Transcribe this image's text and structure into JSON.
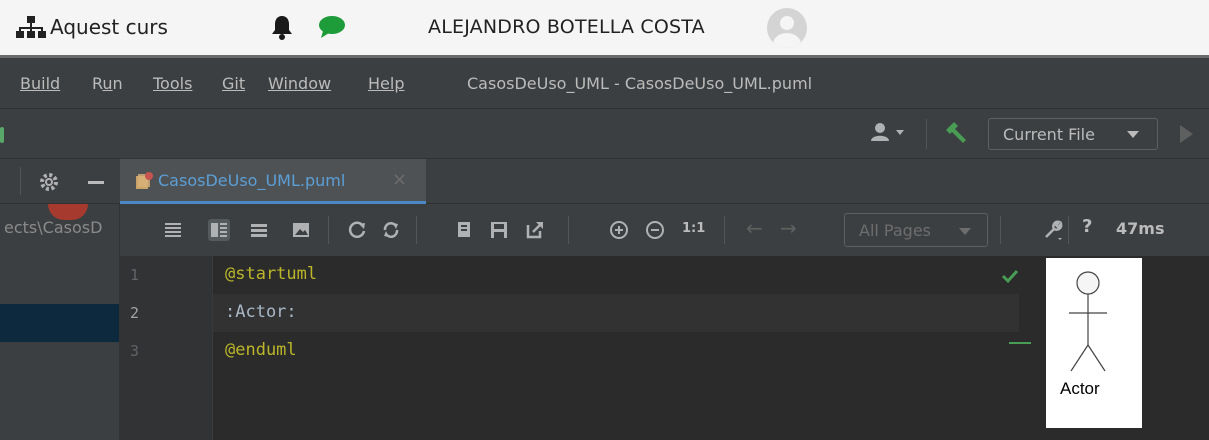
{
  "browser_bar": {
    "site_label": "Aquest curs",
    "user_name": "ALEJANDRO BOTELLA COSTA",
    "icons": [
      "sitemap-icon",
      "bell-icon",
      "chat-icon",
      "avatar-icon"
    ],
    "chat_color": "#1e9c3a"
  },
  "menu": {
    "items": [
      "Build",
      "Run",
      "Tools",
      "Git",
      "Window",
      "Help"
    ],
    "underline_index": [
      0,
      1,
      0,
      0,
      0,
      0
    ],
    "window_title": "CasosDeUso_UML - CasosDeUso_UML.puml"
  },
  "toolbar": {
    "run_config": "Current File"
  },
  "tabs": [
    {
      "label": "CasosDeUso_UML.puml",
      "active": true
    }
  ],
  "project_panel": {
    "path_fragment": "ects\\CasosD"
  },
  "plantuml_toolbar": {
    "zoom_reset": "1:1",
    "pages_select": "All Pages",
    "help": "?",
    "render_time": "47ms"
  },
  "editor": {
    "line_numbers": [
      "1",
      "2",
      "3"
    ],
    "lines": [
      "@startuml",
      ":Actor:",
      "@enduml"
    ],
    "current_line": 2,
    "colors": {
      "keyword": "#bbb529",
      "text": "#a9b7c6",
      "check": "#499c54"
    }
  },
  "preview": {
    "actor_label": "Actor"
  }
}
